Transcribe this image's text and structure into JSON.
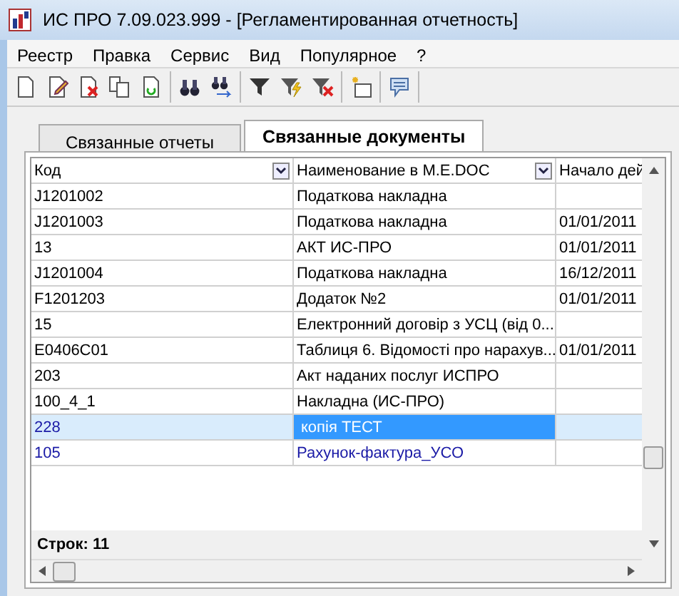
{
  "window": {
    "title": "ИС ПРО 7.09.023.999 - [Регламентированная отчетность]"
  },
  "menu": [
    "Реестр",
    "Правка",
    "Сервис",
    "Вид",
    "Популярное",
    "?"
  ],
  "tabs": [
    {
      "label": "Связанные отчеты",
      "selected": false
    },
    {
      "label": "Связанные документы",
      "selected": true
    }
  ],
  "table": {
    "columns": [
      "Код",
      "Наименование в M.E.DOC",
      "Начало дей"
    ],
    "rows": [
      {
        "cells": [
          "J1201002",
          "Податкова накладна",
          ""
        ],
        "selected": false,
        "color": "#000000"
      },
      {
        "cells": [
          "J1201003",
          "Податкова накладна",
          "01/01/2011"
        ],
        "selected": false,
        "color": "#000000"
      },
      {
        "cells": [
          "13",
          "АКТ ИС-ПРО",
          "01/01/2011"
        ],
        "selected": false,
        "color": "#000000"
      },
      {
        "cells": [
          "J1201004",
          "Податкова накладна",
          "16/12/2011"
        ],
        "selected": false,
        "color": "#000000"
      },
      {
        "cells": [
          "F1201203",
          "Додаток №2",
          "01/01/2011"
        ],
        "selected": false,
        "color": "#000000"
      },
      {
        "cells": [
          "15",
          "Електронний договір з УСЦ (від 0...",
          ""
        ],
        "selected": false,
        "color": "#000000"
      },
      {
        "cells": [
          "E0406C01",
          "Таблиця 6. Відомості про нарахув...",
          "01/01/2011"
        ],
        "selected": false,
        "color": "#000000"
      },
      {
        "cells": [
          "203",
          "Акт наданих послуг ИСПРО",
          ""
        ],
        "selected": false,
        "color": "#000000"
      },
      {
        "cells": [
          "100_4_1",
          "Накладна (ИС-ПРО)",
          ""
        ],
        "selected": false,
        "color": "#000000"
      },
      {
        "cells": [
          "228",
          "копія ТЕСТ",
          ""
        ],
        "selected": true,
        "color": "#1a1aa6"
      },
      {
        "cells": [
          "105",
          "Рахунок-фактура_УСО",
          ""
        ],
        "selected": false,
        "color": "#1a1aa6"
      }
    ],
    "footer": "Строк: 11"
  }
}
